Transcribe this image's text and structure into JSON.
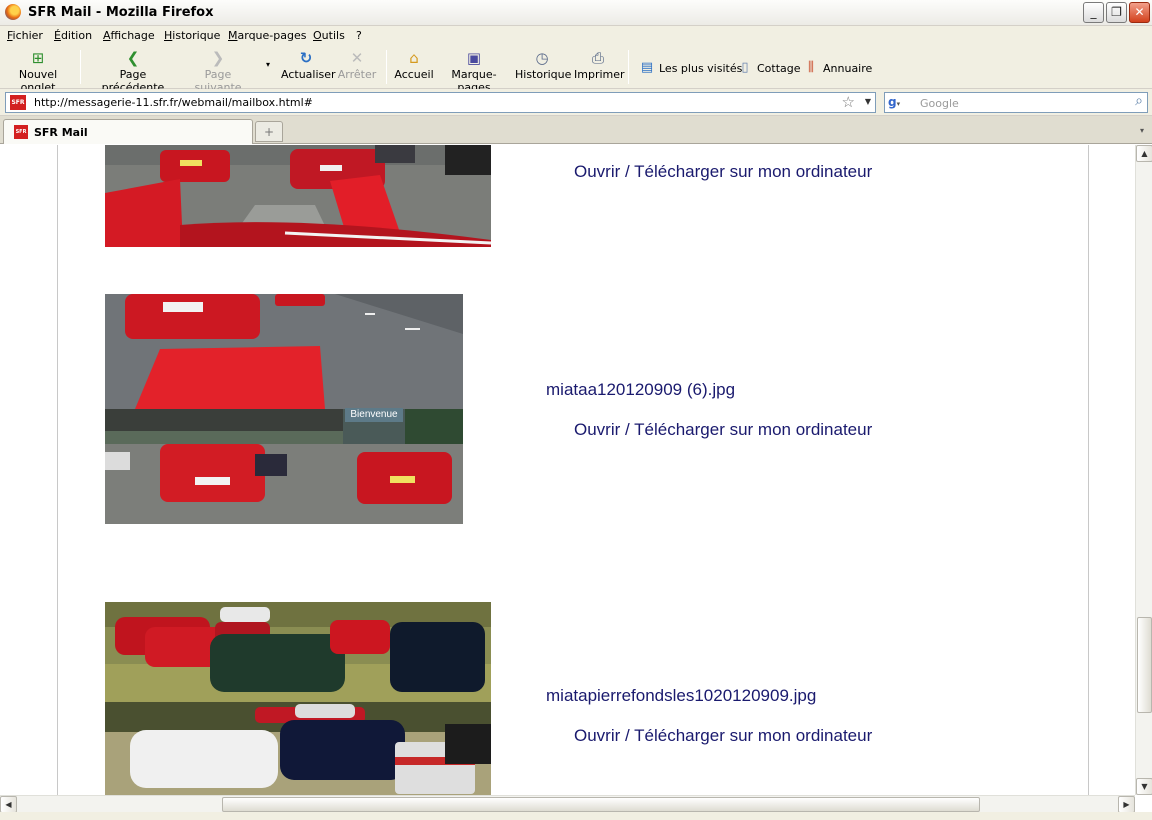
{
  "window": {
    "title": "SFR Mail - Mozilla Firefox"
  },
  "menu": [
    "Fichier",
    "Édition",
    "Affichage",
    "Historique",
    "Marque-pages",
    "Outils",
    "?"
  ],
  "toolbar": {
    "new_tab": "Nouvel onglet",
    "back": "Page précédente",
    "forward": "Page suivante",
    "reload": "Actualiser",
    "stop": "Arrêter",
    "home": "Accueil",
    "bookmarks": "Marque-pages",
    "history": "Historique",
    "print": "Imprimer"
  },
  "bookmarks_bar": [
    "Les plus visités",
    "Cottage",
    "Annuaire"
  ],
  "address": {
    "url": "http://messagerie-11.sfr.fr/webmail/mailbox.html#",
    "favicon_text": "SFR"
  },
  "search": {
    "placeholder": "Google"
  },
  "tabs": [
    {
      "label": "SFR Mail",
      "favicon_text": "SFR"
    }
  ],
  "attachments": [
    {
      "filename": "",
      "link": "Ouvrir / Télécharger sur mon ordinateur"
    },
    {
      "filename": "miataa120120909 (6).jpg",
      "link": "Ouvrir / Télécharger sur mon ordinateur"
    },
    {
      "filename": "miatapierrefondsles1020120909.jpg",
      "link": "Ouvrir / Télécharger sur mon ordinateur"
    }
  ],
  "colors": {
    "link": "#1a1a6e",
    "chrome": "#f1efe2",
    "car_red": "#d11a22"
  }
}
